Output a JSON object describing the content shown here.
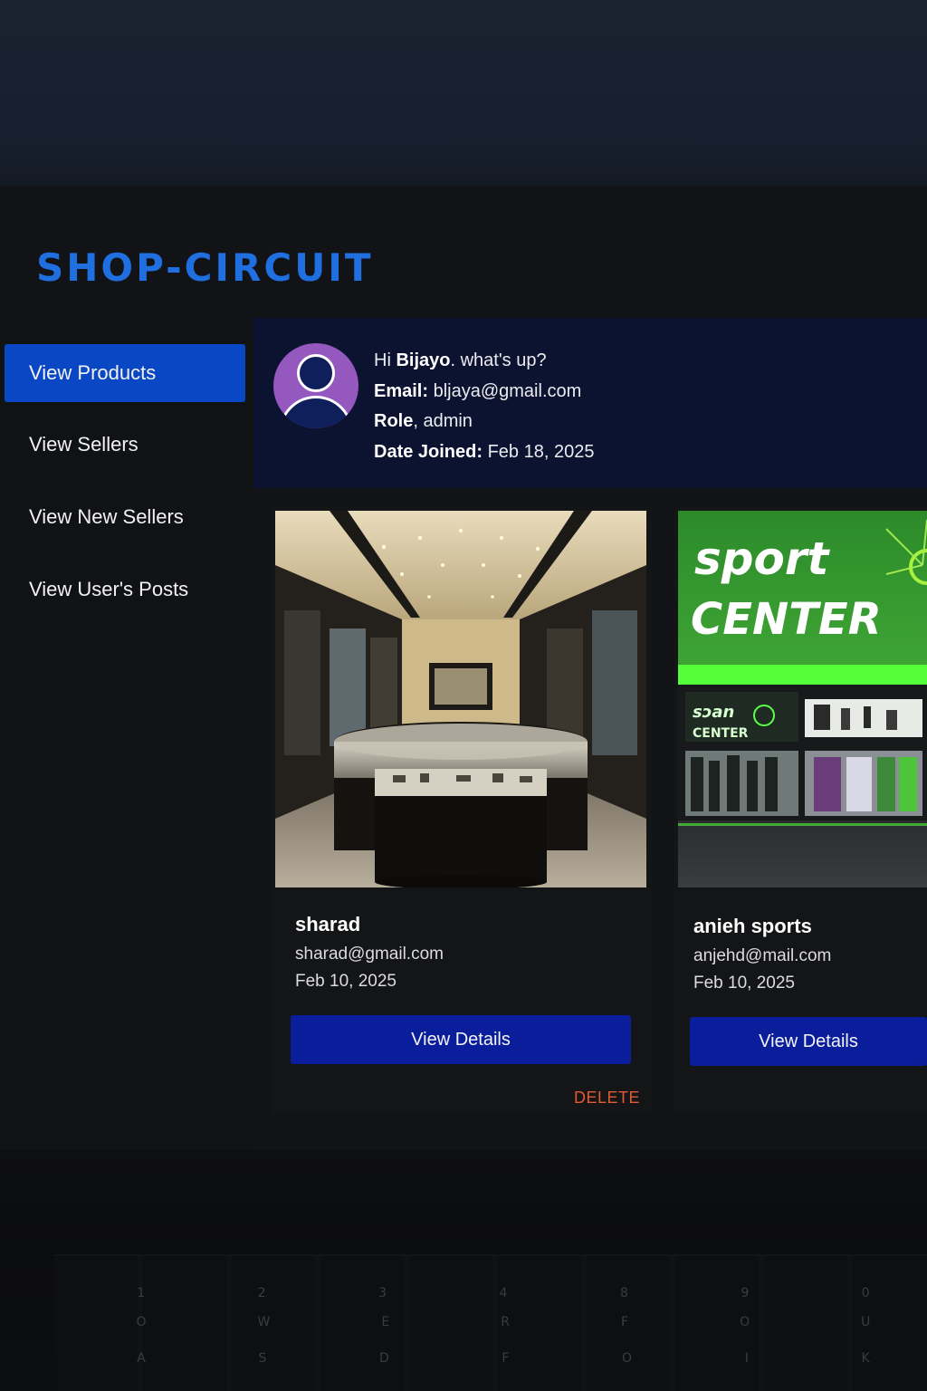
{
  "app": {
    "brand": "SHOP-CIRCUIT",
    "accent_color": "#1f6fe0",
    "active_nav_color": "#0a47c4"
  },
  "sidebar": {
    "items": [
      {
        "label": "View Products",
        "active": true
      },
      {
        "label": "View Sellers",
        "active": false
      },
      {
        "label": "View New Sellers",
        "active": false
      },
      {
        "label": "View User's Posts",
        "active": false
      }
    ]
  },
  "profile": {
    "greeting_prefix": "Hi",
    "name": "Bijayo",
    "greeting_suffix": ". what's up?",
    "email_label": "Email:",
    "email": "bljaya@gmail.com",
    "role_label": "Role",
    "role": ", admin",
    "joined_label": "Date Joined:",
    "joined": "Feb 18, 2025",
    "avatar_icon": "user-avatar-icon"
  },
  "sellers": [
    {
      "name": "sharad",
      "email": "sharad@gmail.com",
      "date": "Feb 10, 2025",
      "button": "View Details",
      "delete": "DELETE",
      "image": "jewelry-store-interior"
    },
    {
      "name": "anieh sports",
      "email": "anjehd@mail.com",
      "date": "Feb 10, 2025",
      "button": "View Details",
      "image": "sport-center-storefront",
      "image_text": {
        "headline1": "sport",
        "headline2": "CENTER",
        "sign1": "sɔan",
        "sign2": "CENTER"
      }
    }
  ],
  "keyboard": {
    "row1": [
      "1",
      "2",
      "3",
      "4",
      "8",
      "9",
      "0"
    ],
    "row2": [
      "O",
      "W",
      "E",
      "R",
      "F",
      "O",
      "U"
    ],
    "row3": [
      "A",
      "S",
      "D",
      "F",
      "O",
      "I",
      "K"
    ]
  }
}
